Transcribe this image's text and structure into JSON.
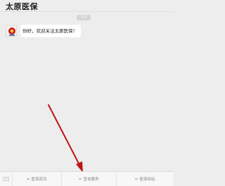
{
  "header": {
    "title": "太原医保"
  },
  "chat": {
    "timestamp": "下午",
    "message_text": "你好，欢迎关注太原医保！",
    "avatar_icon": "emblem-icon"
  },
  "menu": {
    "keyboard_icon": "keyboard-icon",
    "items": [
      {
        "label": "医保资讯"
      },
      {
        "label": "查询服务"
      },
      {
        "label": "医保网站"
      }
    ]
  },
  "colors": {
    "background": "#ededed",
    "bubble": "#ffffff",
    "arrow": "#c0151b",
    "emblem": "#c8161d"
  }
}
